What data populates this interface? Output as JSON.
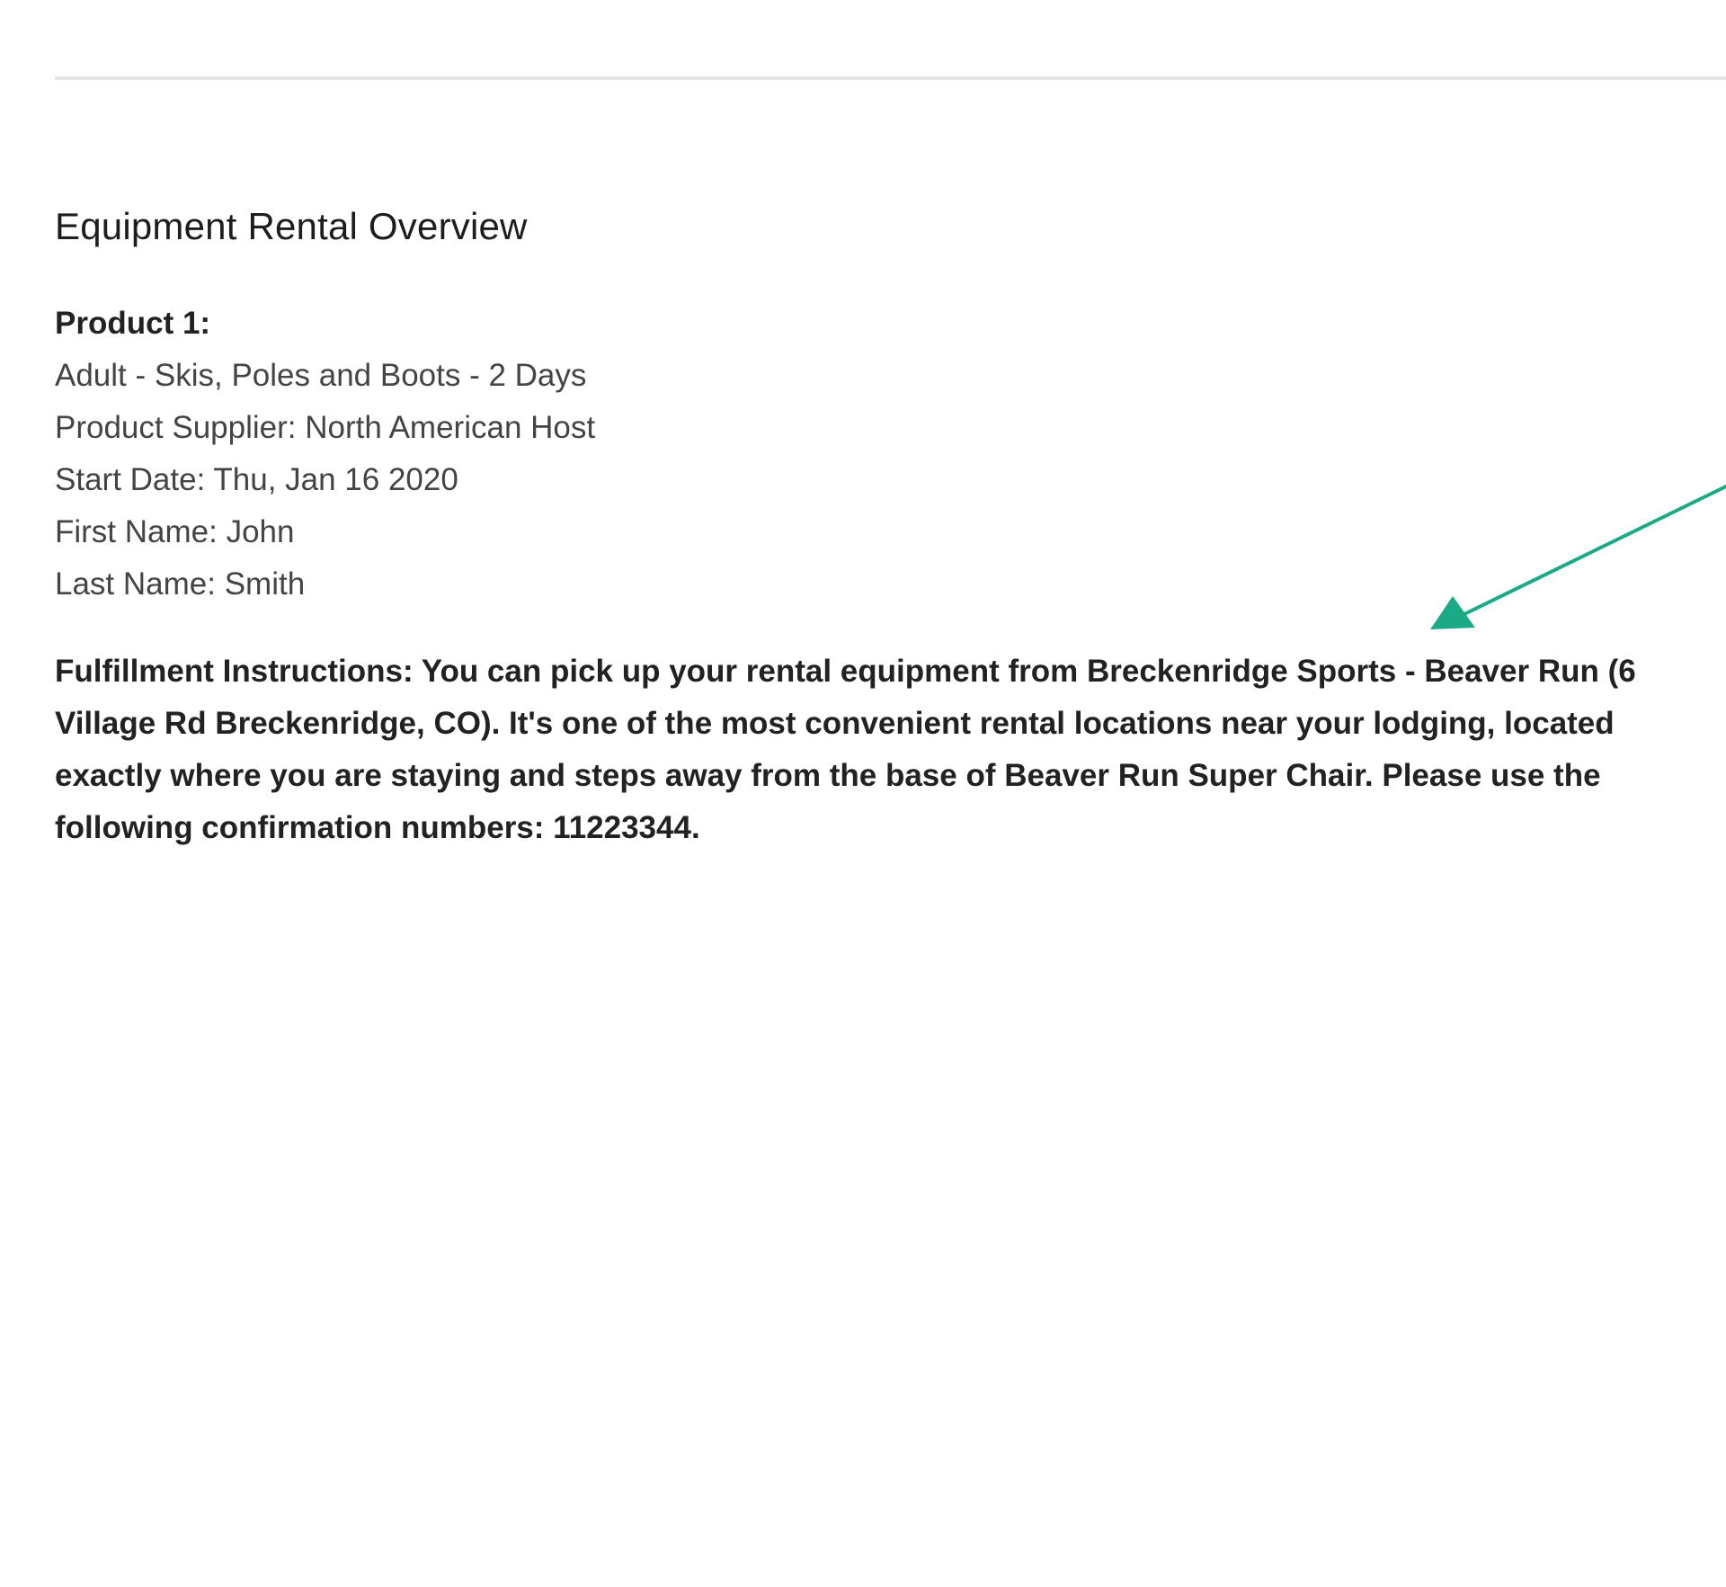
{
  "overview": {
    "title": "Equipment Rental Overview",
    "product": {
      "heading": "Product 1:",
      "name": "Adult - Skis, Poles and Boots - 2 Days",
      "supplier": "Product Supplier: North American Host",
      "start_date": "Start Date: Thu, Jan 16 2020",
      "first_name": "First Name: John",
      "last_name": "Last Name: Smith"
    },
    "fulfillment": {
      "lines": [
        "Fulfillment Instructions: You can pick up your rental equipment from Breckenridge Sports - Beaver Run (6",
        "Village Rd Breckenridge, CO). It's one of the most convenient rental locations near your lodging, located",
        "exactly where you are staying and steps away from the base of Beaver Run Super Chair. Please use the",
        "following confirmation numbers: 11223344."
      ]
    }
  },
  "annotation": {
    "arrow_color": "#1aaa85",
    "icon": "annotation-arrow-icon"
  }
}
